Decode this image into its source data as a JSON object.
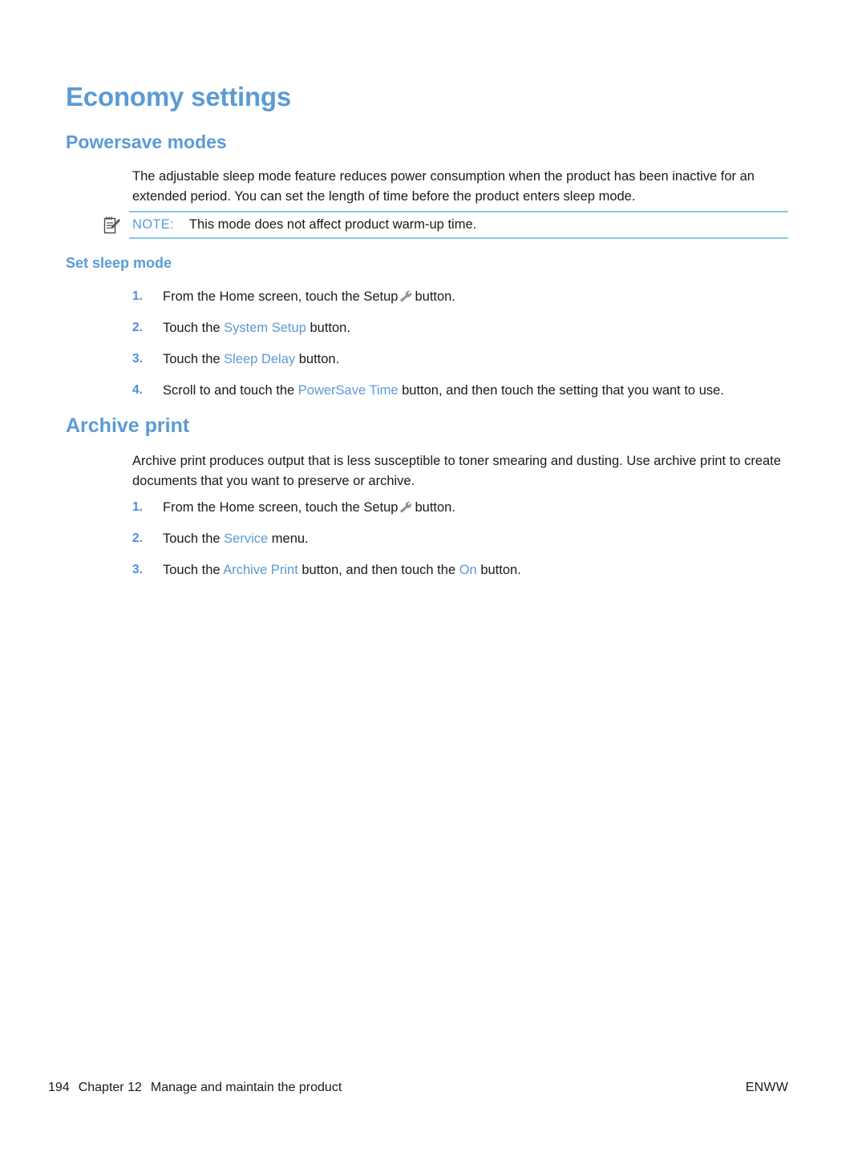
{
  "page": {
    "title": "Economy settings"
  },
  "sections": {
    "powersave": {
      "heading": "Powersave modes",
      "paragraph": "The adjustable sleep mode feature reduces power consumption when the product has been inactive for an extended period. You can set the length of time before the product enters sleep mode.",
      "note": {
        "icon": "note-clipboard-pencil-icon",
        "label": "NOTE:",
        "text": "This mode does not affect product warm-up time."
      },
      "subheading": "Set sleep mode",
      "steps": [
        {
          "number": "1.",
          "pre": "From the Home screen, touch the Setup",
          "icon": "wrench-icon",
          "post": "button."
        },
        {
          "number": "2.",
          "pre": "Touch the",
          "ui": "System Setup",
          "post": "button."
        },
        {
          "number": "3.",
          "pre": "Touch the",
          "ui": "Sleep Delay",
          "post": "button."
        },
        {
          "number": "4.",
          "pre": "Scroll to and touch the",
          "ui": "PowerSave Time",
          "post": "button, and then touch the setting that you want to use."
        }
      ]
    },
    "archive": {
      "heading": "Archive print",
      "paragraph": "Archive print produces output that is less susceptible to toner smearing and dusting. Use archive print to create documents that you want to preserve or archive.",
      "steps": [
        {
          "number": "1.",
          "pre": "From the Home screen, touch the Setup",
          "icon": "wrench-icon",
          "post": "button."
        },
        {
          "number": "2.",
          "pre": "Touch the",
          "ui": "Service",
          "post": "menu."
        },
        {
          "number": "3.",
          "pre": "Touch the",
          "ui": "Archive Print",
          "post": "button, and then touch the",
          "ui2": "On",
          "post2": "button."
        }
      ]
    }
  },
  "footer": {
    "page_number": "194",
    "chapter": "Chapter 12",
    "chapter_title": "Manage and maintain the product",
    "locale": "ENWW"
  },
  "colors": {
    "heading_blue": "#5a9bd5",
    "ui_blue": "#5a9bd5",
    "list_number_blue": "#4a90d9",
    "rule_blue": "#86c5e8",
    "body_text": "#1a1a1a"
  }
}
